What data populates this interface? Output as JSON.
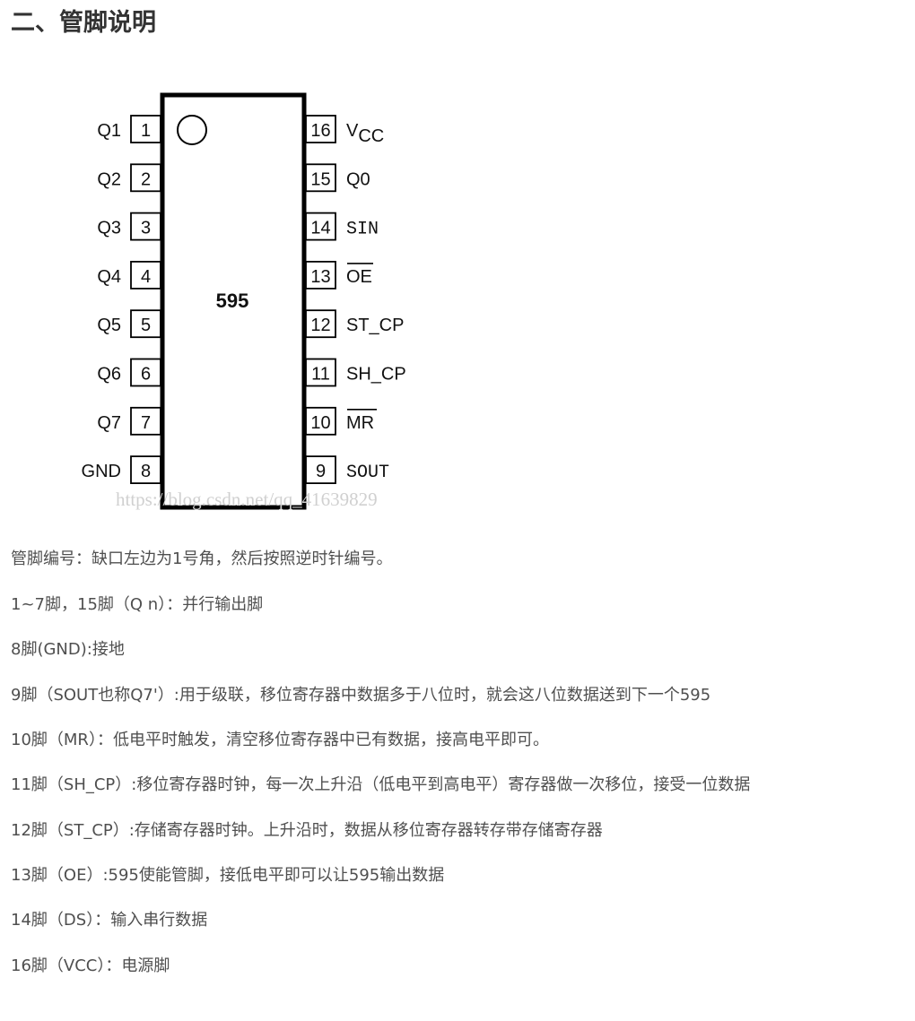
{
  "heading": "二、管脚说明",
  "chip": {
    "label": "595",
    "left_pins": [
      {
        "number": "1",
        "name": "Q1"
      },
      {
        "number": "2",
        "name": "Q2"
      },
      {
        "number": "3",
        "name": "Q3"
      },
      {
        "number": "4",
        "name": "Q4"
      },
      {
        "number": "5",
        "name": "Q5"
      },
      {
        "number": "6",
        "name": "Q6"
      },
      {
        "number": "7",
        "name": "Q7"
      },
      {
        "number": "8",
        "name": "GND"
      }
    ],
    "right_pins": [
      {
        "number": "16",
        "name": "VCC"
      },
      {
        "number": "15",
        "name": "Q0"
      },
      {
        "number": "14",
        "name": "SIN"
      },
      {
        "number": "13",
        "name": "OE"
      },
      {
        "number": "12",
        "name": "ST_CP"
      },
      {
        "number": "11",
        "name": "SH_CP"
      },
      {
        "number": "10",
        "name": "MR"
      },
      {
        "number": "9",
        "name": "SOUT"
      }
    ],
    "watermark": "https://blog.csdn.net/qq_41639829"
  },
  "descriptions": [
    "管脚编号：缺口左边为1号角，然后按照逆时针编号。",
    "1~7脚，15脚（Q n）：并行输出脚",
    "8脚(GND):接地",
    "9脚（SOUT也称Q7'）:用于级联，移位寄存器中数据多于八位时，就会这八位数据送到下一个595",
    "10脚（MR）：低电平时触发，清空移位寄存器中已有数据，接高电平即可。",
    "11脚（SH_CP）:移位寄存器时钟，每一次上升沿（低电平到高电平）寄存器做一次移位，接受一位数据",
    "12脚（ST_CP）:存储寄存器时钟。上升沿时，数据从移位寄存器转存带存储寄存器",
    "13脚（OE）:595使能管脚，接低电平即可以让595输出数据",
    "14脚（DS）：输入串行数据",
    "16脚（VCC）：电源脚"
  ]
}
